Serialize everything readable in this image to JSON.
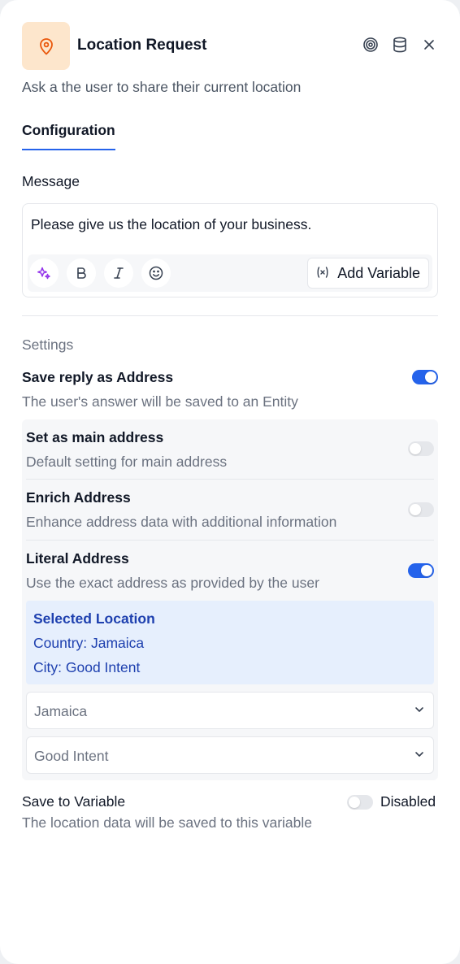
{
  "header": {
    "title": "Location Request",
    "subtitle": "Ask a the user to share their current location",
    "icons": [
      "location-pin-icon",
      "target-icon",
      "database-icon",
      "close-icon"
    ],
    "icon_bg_color": "#fde6cc",
    "icon_color": "#ea580c"
  },
  "tabs": [
    {
      "label": "Configuration",
      "active": true
    }
  ],
  "message": {
    "label": "Message",
    "value": "Please give us the location of your business.",
    "toolbar": {
      "icons": [
        "sparkles-icon",
        "bold-icon",
        "italic-icon",
        "emoji-icon"
      ],
      "add_variable_label": "Add Variable",
      "add_variable_icon": "variable-icon"
    }
  },
  "settings": {
    "label": "Settings",
    "save_reply": {
      "title": "Save reply as Address",
      "description": "The user's answer will be saved to an Entity",
      "enabled": true
    },
    "main_address": {
      "title": "Set as main address",
      "description": "Default setting for main address",
      "enabled": false
    },
    "enrich_address": {
      "title": "Enrich Address",
      "description": "Enhance address data with additional information",
      "enabled": false
    },
    "literal_address": {
      "title": "Literal Address",
      "description": "Use the exact address as provided by the user",
      "enabled": true
    },
    "selected_location": {
      "title": "Selected Location",
      "country_line": "Country: Jamaica",
      "city_line": "City: Good Intent"
    },
    "country_select": {
      "value": "Jamaica"
    },
    "city_select": {
      "value": "Good Intent"
    },
    "save_to_variable": {
      "title": "Save to Variable",
      "description": "The location data will be saved to this variable",
      "status": "Disabled",
      "enabled": false
    }
  },
  "colors": {
    "accent": "#2563eb",
    "selected_bg": "#e6effd",
    "selected_text": "#1e40af",
    "ai_purple": "#9333ea"
  }
}
